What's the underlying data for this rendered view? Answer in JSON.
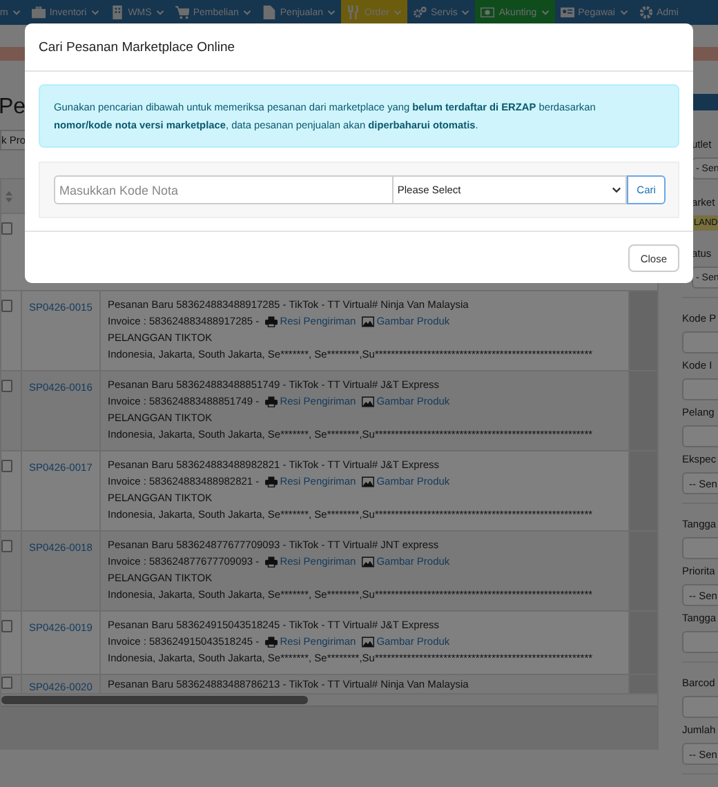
{
  "navbar": {
    "items": [
      {
        "label": "m",
        "color": "#16354f"
      },
      {
        "label": "Inventori",
        "color": "#16354f"
      },
      {
        "label": "WMS",
        "color": "#16354f"
      },
      {
        "label": "Pembelian",
        "color": "#16354f"
      },
      {
        "label": "Penjualan",
        "color": "#16354f"
      },
      {
        "label": "Order",
        "color": "#6c5c0e"
      },
      {
        "label": "Servis",
        "color": "#16354f"
      },
      {
        "label": "Akunting",
        "color": "#0f4d1d"
      },
      {
        "label": "Pegawai",
        "color": "#16354f"
      },
      {
        "label": "Admi",
        "color": "#16354f"
      }
    ]
  },
  "page": {
    "title": "Pe",
    "button": "k Pro"
  },
  "table": {
    "select_all": {
      "checked": false
    },
    "rows": [
      {
        "checked": false,
        "code": "SP0426-0015",
        "title": "Pesanan Baru 583624883488917285 - TikTok - TT Virtual# Ninja Van Malaysia",
        "invoice": "Invoice : 583624883488917285 -",
        "receipt_link": "Resi Pengiriman",
        "image_link": "Gambar Produk",
        "customer": "PELANGGAN TIKTOK",
        "address": "Indonesia, Jakarta, South Jakarta, Se*******, Se********,Su******************************************************"
      },
      {
        "checked": false,
        "code": "SP0426-0016",
        "title": "Pesanan Baru 583624883488851749 - TikTok - TT Virtual# J&T Express",
        "invoice": "Invoice : 583624883488851749 -",
        "receipt_link": "Resi Pengiriman",
        "image_link": "Gambar Produk",
        "customer": "PELANGGAN TIKTOK",
        "address": "Indonesia, Jakarta, South Jakarta, Se*******, Se********,Su******************************************************"
      },
      {
        "checked": false,
        "code": "SP0426-0017",
        "title": "Pesanan Baru 583624883488982821 - TikTok - TT Virtual# J&T Express",
        "invoice": "Invoice : 583624883488982821 -",
        "receipt_link": "Resi Pengiriman",
        "image_link": "Gambar Produk",
        "customer": "PELANGGAN TIKTOK",
        "address": "Indonesia, Jakarta, South Jakarta, Se*******, Se********,Su******************************************************"
      },
      {
        "checked": false,
        "code": "SP0426-0018",
        "title": "Pesanan Baru 583624877677709093 - TikTok - TT Virtual# JNT express",
        "invoice": "Invoice : 583624877677709093 -",
        "receipt_link": "Resi Pengiriman",
        "image_link": "Gambar Produk",
        "customer": "PELANGGAN TIKTOK",
        "address": "Indonesia, Jakarta, South Jakarta, Se*******, Se********,Su******************************************************"
      },
      {
        "checked": false,
        "code": "SP0426-0019",
        "title": "Pesanan Baru 583624915043518245 - TikTok - TT Virtual# J&T Express",
        "invoice": "Invoice : 583624915043518245 -",
        "receipt_link": "Resi Pengiriman",
        "image_link": "Gambar Produk",
        "address": "Indonesia, Jakarta, South Jakarta, Se*******, Se********,Su******************************************************"
      },
      {
        "checked": false,
        "code": "SP0426-0020",
        "title": "Pesanan Baru 583624883488786213 - TikTok - TT Virtual# Ninja Van Malaysia"
      }
    ]
  },
  "filter_groups": [
    [
      {
        "kind": "label",
        "text": "utlet"
      },
      {
        "kind": "select",
        "text": "- Sen"
      },
      {
        "kind": "label",
        "text": "arket"
      },
      {
        "kind": "badge",
        "text": "LAND"
      },
      {
        "kind": "label",
        "text": "atus"
      },
      {
        "kind": "select",
        "text": "- Sen"
      }
    ],
    [
      {
        "kind": "label",
        "text": "Kode P"
      },
      {
        "kind": "input"
      },
      {
        "kind": "label",
        "text": "Kode I"
      },
      {
        "kind": "input"
      },
      {
        "kind": "label",
        "text": "Pelang"
      },
      {
        "kind": "input"
      },
      {
        "kind": "label",
        "text": "Ekspec"
      },
      {
        "kind": "select",
        "text": "-- Sen"
      }
    ],
    [
      {
        "kind": "label",
        "text": "Tangga"
      },
      {
        "kind": "input"
      },
      {
        "kind": "label",
        "text": "Priorita"
      },
      {
        "kind": "select",
        "text": "-- Sen"
      },
      {
        "kind": "label",
        "text": "Tangga"
      },
      {
        "kind": "input"
      }
    ],
    [
      {
        "kind": "label",
        "text": "Barcod"
      },
      {
        "kind": "input"
      },
      {
        "kind": "label",
        "text": "Jumlah"
      },
      {
        "kind": "select",
        "text": "-- Sen"
      }
    ]
  ],
  "modal": {
    "title": "Cari Pesanan Marketplace Online",
    "notice": "Gunakan pencarian dibawah untuk memeriksa pesanan dari marketplace yang **belum terdaftar di ERZAP** berdasarkan **nomor/kode nota versi marketplace**, data pesanan penjualan akan **diperbaharui otomatis**.",
    "search": {
      "placeholder": "Masukkan Kode Nota"
    },
    "select": {
      "value": "Please Select"
    },
    "search_button": "Cari",
    "close_button": "Close"
  }
}
